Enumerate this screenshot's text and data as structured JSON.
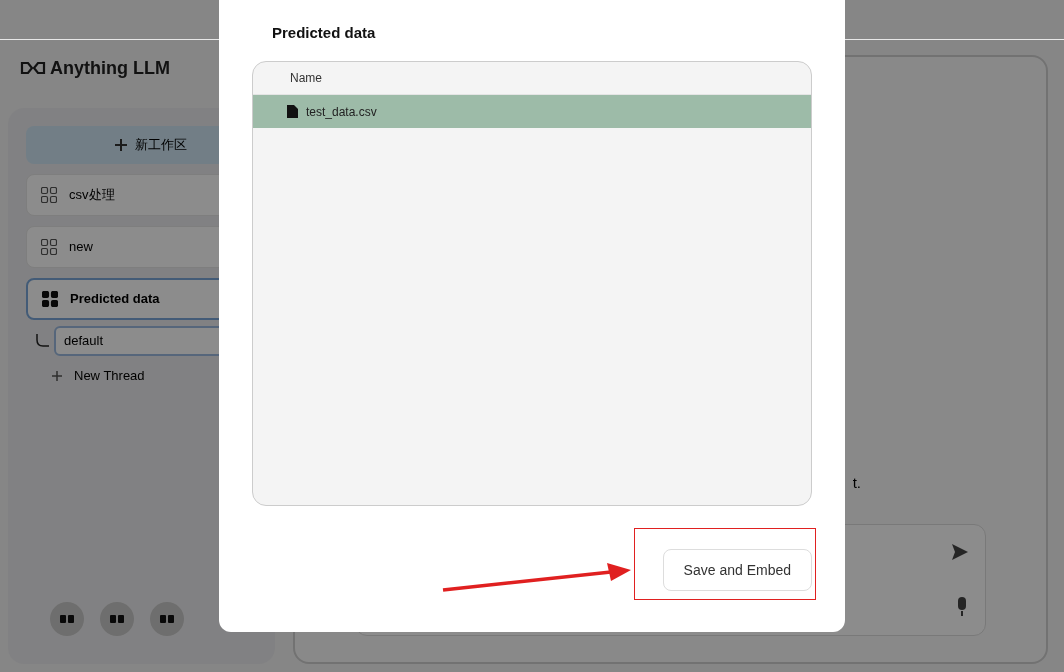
{
  "sidebar": {
    "logo": "Anything LLM",
    "new_workspace_button": "新工作区",
    "workspaces": [
      {
        "name": "csv处理",
        "selected": false
      },
      {
        "name": "new",
        "selected": false
      },
      {
        "name": "Predicted data",
        "selected": true,
        "threads": [
          {
            "name": "default",
            "selected": true
          }
        ]
      }
    ],
    "new_thread": "New Thread"
  },
  "main": {
    "text_fragment": "t."
  },
  "modal": {
    "title": "Predicted data",
    "table": {
      "columns": [
        "Name"
      ],
      "rows": [
        {
          "name": "test_data.csv",
          "selected": true
        }
      ]
    },
    "button": "Save and Embed"
  }
}
